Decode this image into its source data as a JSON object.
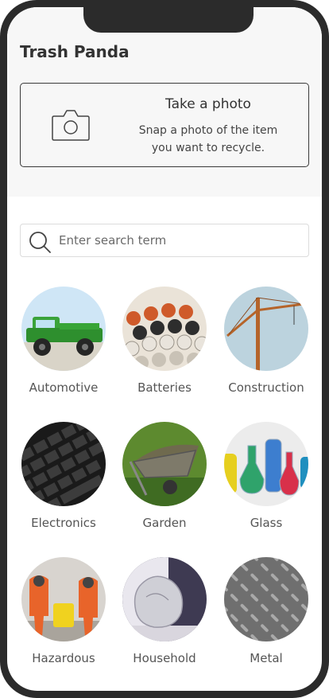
{
  "app": {
    "title": "Trash Panda"
  },
  "photo_card": {
    "title": "Take a photo",
    "desc_line1": "Snap a photo of the item",
    "desc_line2": "you want to recycle.",
    "icon": "camera-icon"
  },
  "search": {
    "placeholder": "Enter search term",
    "value": "",
    "icon": "search-icon"
  },
  "categories": [
    {
      "label": "Automotive"
    },
    {
      "label": "Batteries"
    },
    {
      "label": "Construction"
    },
    {
      "label": "Electronics"
    },
    {
      "label": "Garden"
    },
    {
      "label": "Glass"
    },
    {
      "label": "Hazardous"
    },
    {
      "label": "Household"
    },
    {
      "label": "Metal"
    }
  ],
  "colors": {
    "frame": "#2b2b2b",
    "header_bg": "#f7f7f7",
    "text": "#333333"
  }
}
